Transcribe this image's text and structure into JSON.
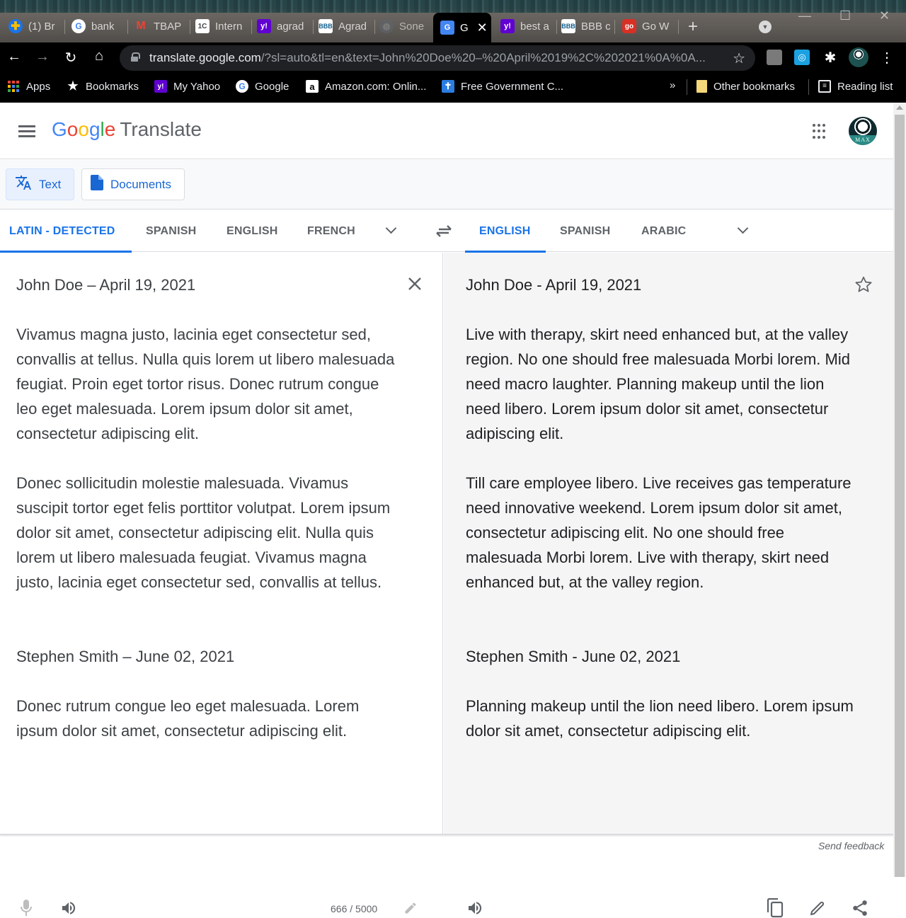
{
  "browser": {
    "tabs": [
      {
        "title": "(1) Br",
        "icon": "cross-health-icon",
        "color": "#1a73e8"
      },
      {
        "title": "bank",
        "icon": "google-icon",
        "color": "#ffffff"
      },
      {
        "title": "TBAP",
        "icon": "gmail-icon",
        "color": "#ea4335"
      },
      {
        "title": "Intern",
        "icon": "1c-site-icon",
        "color": "#ffffff"
      },
      {
        "title": "agrad",
        "icon": "yahoo-icon",
        "color": "#6001d2"
      },
      {
        "title": "Agrad",
        "icon": "bbb-icon",
        "color": "#ffffff"
      },
      {
        "title": "Sone",
        "icon": "globe-icon",
        "color": "#5f6368"
      },
      {
        "title": "Go W",
        "icon": "go-site-icon",
        "color": "#d93025"
      }
    ],
    "tab_mid": [
      {
        "title": "best a",
        "icon": "yahoo-icon",
        "color": "#6001d2"
      },
      {
        "title": "BBB c",
        "icon": "bbb-icon",
        "color": "#ffffff"
      }
    ],
    "active_tab": {
      "title": "G",
      "icon": "google-translate-icon"
    },
    "new_tab_label": "+",
    "address": {
      "host": "translate.google.com",
      "path": "/?sl=auto&tl=en&text=John%20Doe%20–%20April%2019%2C%202021%0A%0A..."
    },
    "bookmarks": [
      {
        "label": "Apps",
        "icon": "apps-grid-icon"
      },
      {
        "label": "Bookmarks",
        "icon": "star-icon"
      },
      {
        "label": "My Yahoo",
        "icon": "yahoo-icon"
      },
      {
        "label": "Google",
        "icon": "google-icon"
      },
      {
        "label": "Amazon.com: Onlin...",
        "icon": "amazon-icon"
      },
      {
        "label": "Free Government C...",
        "icon": "person-icon"
      }
    ],
    "overflow_label": "»",
    "other_bookmarks": "Other bookmarks",
    "reading_list": "Reading list"
  },
  "app": {
    "logo_google": [
      "G",
      "o",
      "o",
      "g",
      "l",
      "e"
    ],
    "logo_product": "Translate",
    "modes": [
      {
        "label": "Text",
        "active": true
      },
      {
        "label": "Documents",
        "active": false
      }
    ],
    "source_langs": [
      "LATIN - DETECTED",
      "SPANISH",
      "ENGLISH",
      "FRENCH"
    ],
    "target_langs": [
      "ENGLISH",
      "SPANISH",
      "ARABIC"
    ],
    "accent_color": "#1a73e8"
  },
  "source": {
    "heading1": "John Doe – April 19, 2021",
    "para1": "Vivamus magna justo, lacinia eget consectetur sed, convallis at tellus. Nulla quis lorem ut libero malesuada feugiat. Proin eget tortor risus. Donec rutrum congue leo eget malesuada. Lorem ipsum dolor sit amet, consectetur adipiscing elit.",
    "para2": "Donec sollicitudin molestie malesuada. Vivamus suscipit tortor eget felis porttitor volutpat. Lorem ipsum dolor sit amet, consectetur adipiscing elit. Nulla quis lorem ut libero malesuada feugiat. Vivamus magna justo, lacinia eget consectetur sed, convallis at tellus.",
    "heading2": "Stephen Smith – June 02, 2021",
    "para3": "Donec rutrum congue leo eget malesuada. Lorem ipsum dolor sit amet, consectetur adipiscing elit.",
    "char_count": "666 / 5000"
  },
  "target": {
    "heading1": "John Doe - April 19, 2021",
    "para1": "Live with therapy, skirt need enhanced but, at the valley region. No one should free malesuada Morbi lorem. Mid need macro laughter. Planning makeup until the lion need libero. Lorem ipsum dolor sit amet, consectetur adipiscing elit.",
    "para2": "Till care employee libero. Live receives gas temperature need innovative weekend. Lorem ipsum dolor sit amet, consectetur adipiscing elit. No one should free malesuada Morbi lorem. Live with therapy, skirt need enhanced but, at the valley region.",
    "heading2": "Stephen Smith - June 02, 2021",
    "para3": "Planning makeup until the lion need libero. Lorem ipsum dolor sit amet, consectetur adipiscing elit."
  },
  "footer": {
    "send_feedback": "Send feedback"
  }
}
